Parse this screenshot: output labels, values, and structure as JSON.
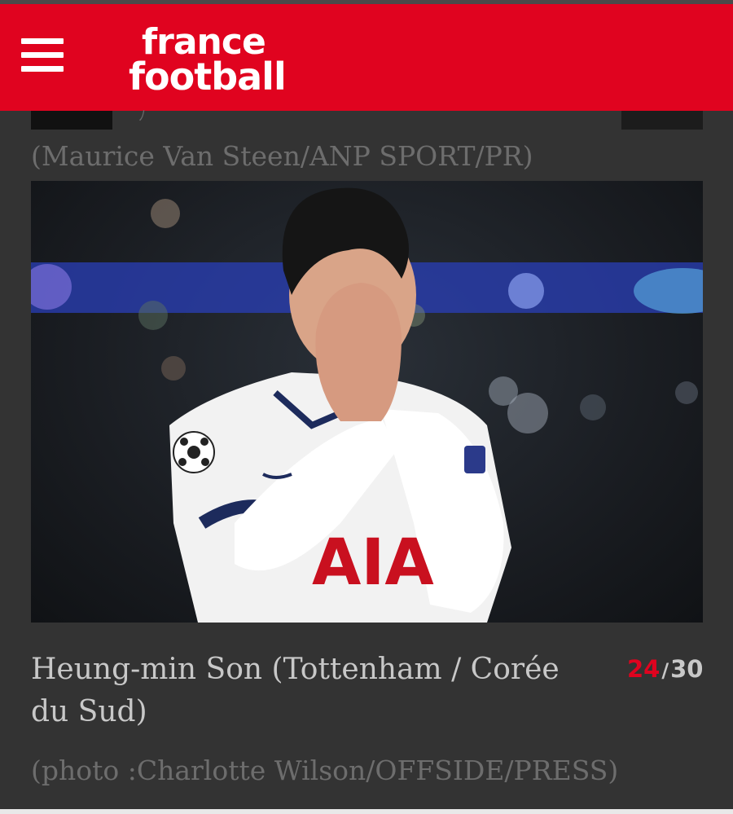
{
  "header": {
    "brand_line1": "france",
    "brand_line2": "football",
    "brand_color": "#e0031f"
  },
  "slide": {
    "previous_credit": "(Maurice Van Steen/ANP SPORT/PR)",
    "caption": "Heung-min Son (Tottenham / Corée du Sud)",
    "current_index": "24",
    "separator": "/",
    "total": "30",
    "photo_credit": "(photo :Charlotte Wilson/OFFSIDE/PRESS)",
    "photo_jersey_text": "AIA"
  },
  "icons": {
    "menu": "hamburger-menu-icon"
  }
}
